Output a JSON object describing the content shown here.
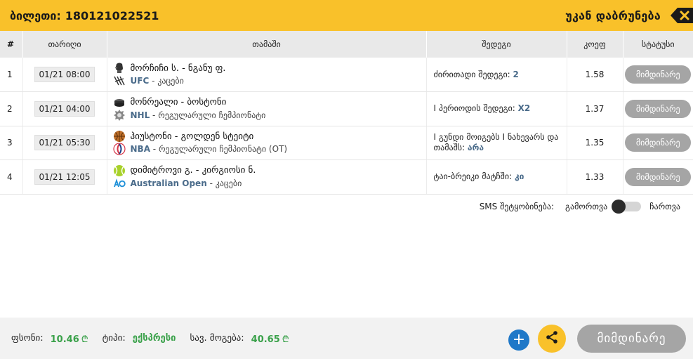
{
  "header": {
    "ticket_label": "ბილეთი:",
    "ticket_number": "180121022521",
    "back_label": "უკან დაბრუნება"
  },
  "table": {
    "columns": [
      "#",
      "თარიღი",
      "თამაში",
      "შედეგი",
      "კოეფ",
      "სტატუსი"
    ],
    "rows": [
      {
        "num": "1",
        "date": "01/21 08:00",
        "title": "მორჩიჩი ს. - ნგანუ ფ.",
        "league_name": "UFC",
        "league_rest": " - კაცები",
        "result_text": "ძირითადი შედეგი: ",
        "result_value": "2",
        "coef": "1.58",
        "status": "მიმდინარე",
        "sport_icon": "mma-glove-icon",
        "league_icon": "ufc-logo-icon"
      },
      {
        "num": "2",
        "date": "01/21 04:00",
        "title": "მონრეალი - ბოსტონი",
        "league_name": "NHL",
        "league_rest": " - რეგულარული ჩემპიონატი",
        "result_text": "I პერიოდის შედეგი: ",
        "result_value": "X2",
        "coef": "1.37",
        "status": "მიმდინარე",
        "sport_icon": "hockey-puck-icon",
        "league_icon": "nhl-logo-icon"
      },
      {
        "num": "3",
        "date": "01/21 05:30",
        "title": "ჰიუსტონი - გოლდენ სტეიტი",
        "league_name": "NBA",
        "league_rest": " - რეგულარული ჩემპიონატი (OT)",
        "result_text": "I გუნდი მოიგებს I ნახევარს და თამაშს: ",
        "result_value": "არა",
        "coef": "1.35",
        "status": "მიმდინარე",
        "sport_icon": "basketball-icon",
        "league_icon": "nba-logo-icon"
      },
      {
        "num": "4",
        "date": "01/21 12:05",
        "title": "დიმიტროვი გ. - კირგიოსი ნ.",
        "league_name": "Australian Open",
        "league_rest": " - კაცები",
        "result_text": "ტაი-ბრეიკი მატჩში: ",
        "result_value": "კი",
        "coef": "1.33",
        "status": "მიმდინარე",
        "sport_icon": "tennis-ball-icon",
        "league_icon": "ao-logo-icon"
      }
    ]
  },
  "sms": {
    "label": "SMS შეტყობინება:",
    "off_label": "გამორთვა",
    "on_label": "ჩართვა",
    "enabled": false
  },
  "footer": {
    "price_label": "ფსონი:",
    "price_value": "10.46",
    "type_label": "ტიპი:",
    "type_value": "ექსპრესი",
    "win_label": "სავ. მოგება:",
    "win_value": "40.65",
    "currency": "₾",
    "plus_label": "+",
    "status_button": "მიმდინარე"
  },
  "colors": {
    "accent_yellow": "#f9c12a",
    "green": "#3aa14a",
    "blue": "#1f78c8",
    "status_gray": "#a5a5a5"
  }
}
